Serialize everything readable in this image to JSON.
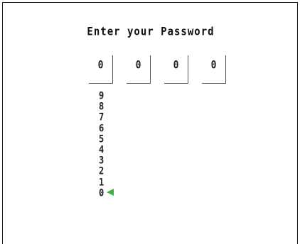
{
  "title": "Enter your Password",
  "password_digits": [
    "0",
    "0",
    "0",
    "0"
  ],
  "digit_options": [
    "9",
    "8",
    "7",
    "6",
    "5",
    "4",
    "3",
    "2",
    "1",
    "0"
  ],
  "selected_option": "0",
  "colors": {
    "background": "#ffffff",
    "text": "#222222",
    "cursor": "#3cb043"
  }
}
